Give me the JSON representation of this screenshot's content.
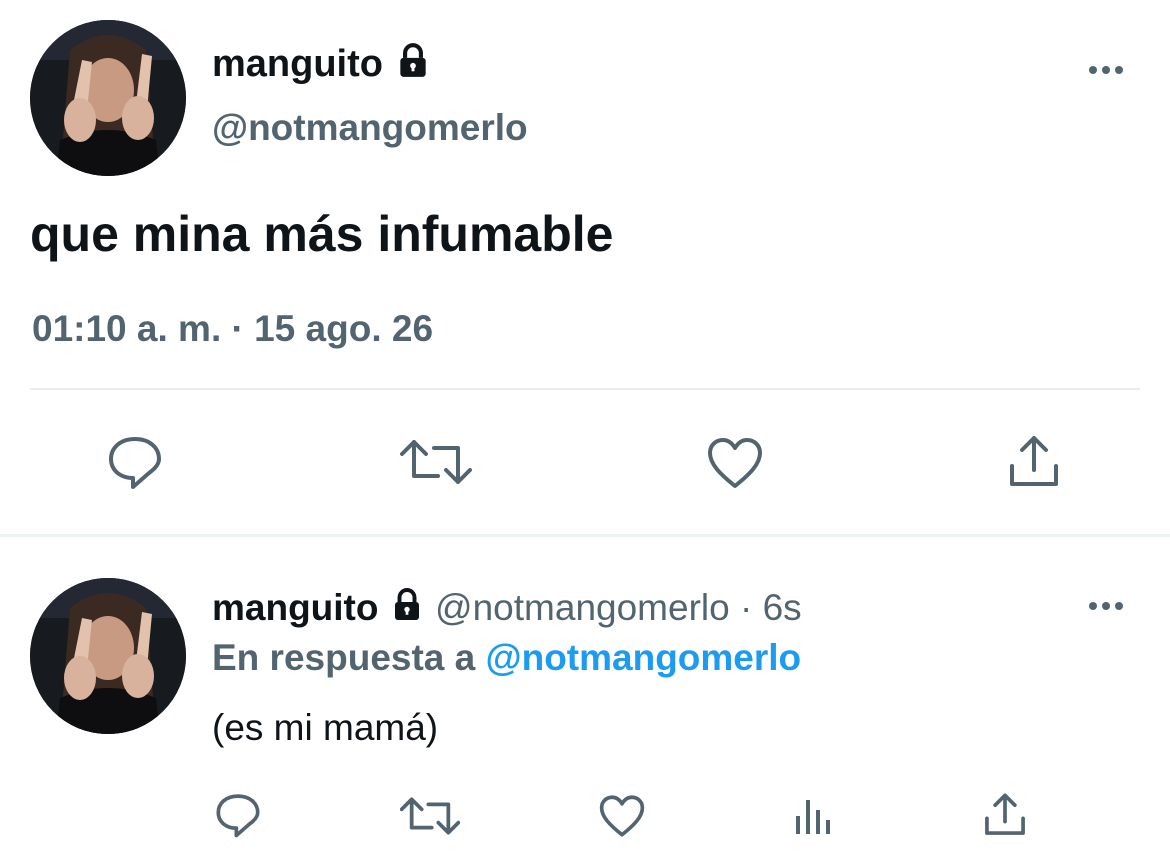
{
  "main_tweet": {
    "display_name": "manguito",
    "handle": "@notmangomerlo",
    "text": "que mina más infumable",
    "timestamp": "01:10 a. m. · 15 ago. 26",
    "icons": {
      "more": "more-horizontal-icon",
      "lock": "lock-icon",
      "actions": [
        "reply-icon",
        "retweet-icon",
        "like-icon",
        "share-icon"
      ]
    }
  },
  "reply_tweet": {
    "display_name": "manguito",
    "handle": "@notmangomerlo",
    "separator": "·",
    "age": "6s",
    "replying_to_prefix": "En respuesta a",
    "replying_to_handle": "@notmangomerlo",
    "text": "(es mi mamá)",
    "icons": {
      "more": "more-horizontal-icon",
      "lock": "lock-icon",
      "actions": [
        "reply-icon",
        "retweet-icon",
        "like-icon",
        "analytics-icon",
        "share-icon"
      ]
    }
  },
  "colors": {
    "text_primary": "#0f1419",
    "text_secondary": "#536471",
    "link_blue": "#1d9bf0",
    "divider": "#e6ecf0"
  }
}
